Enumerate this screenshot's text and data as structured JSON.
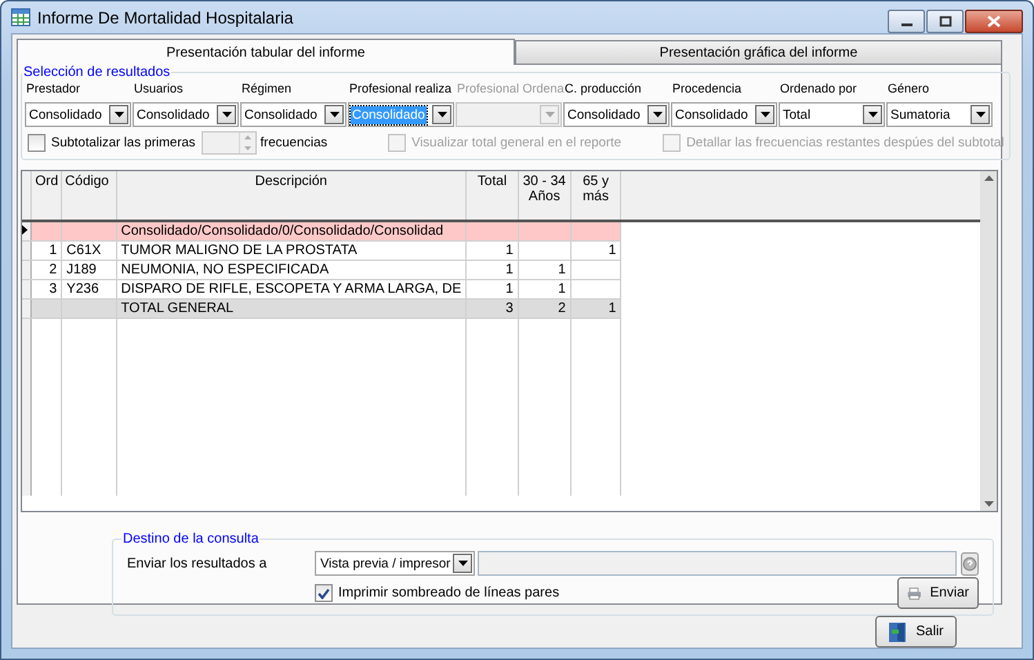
{
  "window": {
    "title": "Informe De Mortalidad Hospitalaria"
  },
  "tabs": [
    {
      "label": "Presentación tabular del informe",
      "selected": true
    },
    {
      "label": "Presentación gráfica del informe",
      "selected": false
    }
  ],
  "selection": {
    "title": "Selección de resultados",
    "filters": [
      {
        "label": "Prestador",
        "value": "Consolidado",
        "disabled": false,
        "focused": false
      },
      {
        "label": "Usuarios",
        "value": "Consolidado",
        "disabled": false,
        "focused": false
      },
      {
        "label": "Régimen",
        "value": "Consolidado",
        "disabled": false,
        "focused": false
      },
      {
        "label": "Profesional realiza",
        "value": "Consolidado",
        "disabled": false,
        "focused": true
      },
      {
        "label": "Profesional Ordena",
        "disabled": true,
        "focused": false
      },
      {
        "label": "C. producción",
        "value": "Consolidado",
        "disabled": false,
        "focused": false
      },
      {
        "label": "Procedencia",
        "value": "Consolidado",
        "disabled": false,
        "focused": false
      },
      {
        "label": "Ordenado por",
        "value": "Total",
        "disabled": false,
        "focused": false
      },
      {
        "label": "Género",
        "value": "Sumatoria",
        "disabled": false,
        "focused": false
      }
    ],
    "subtotal": {
      "label": "Subtotalizar las primeras",
      "checked": false,
      "disabled": false,
      "count_disabled": true,
      "suffix": "frecuencias"
    },
    "options": [
      {
        "label": "Visualizar total general en el reporte",
        "checked": false,
        "disabled": true
      },
      {
        "label": "Detallar las frecuencias restantes despúes del subtotal",
        "checked": false,
        "disabled": true
      }
    ]
  },
  "grid": {
    "columns": [
      "Ord",
      "Código",
      "Descripción",
      "Total",
      "30 - 34 Años",
      "65 y más"
    ],
    "rows": [
      {
        "kind": "group",
        "current": true,
        "description": "Consolidado/Consolidado/0/Consolidado/Consolidad"
      },
      {
        "kind": "item",
        "current": false,
        "ord": "1",
        "code": "C61X",
        "description": "TUMOR MALIGNO DE LA PROSTATA",
        "total": "1",
        "age_65_plus": "1"
      },
      {
        "kind": "item",
        "current": false,
        "ord": "2",
        "code": "J189",
        "description": "NEUMONIA, NO ESPECIFICADA",
        "total": "1",
        "age_30_34": "1"
      },
      {
        "kind": "item",
        "current": false,
        "ord": "3",
        "code": "Y236",
        "description": "DISPARO DE RIFLE, ESCOPETA Y ARMA LARGA, DE",
        "total": "1",
        "age_30_34": "1"
      },
      {
        "kind": "total",
        "current": false,
        "description": "TOTAL GENERAL",
        "total": "3",
        "age_30_34": "2",
        "age_65_plus": "1"
      }
    ]
  },
  "destination": {
    "title": "Destino de la consulta",
    "label": "Enviar los resultados a",
    "target": "Vista previa / impresor",
    "shading": {
      "label": "Imprimir sombreado de líneas pares",
      "checked": true
    },
    "send_button": "Enviar"
  },
  "exit_button": "Salir"
}
